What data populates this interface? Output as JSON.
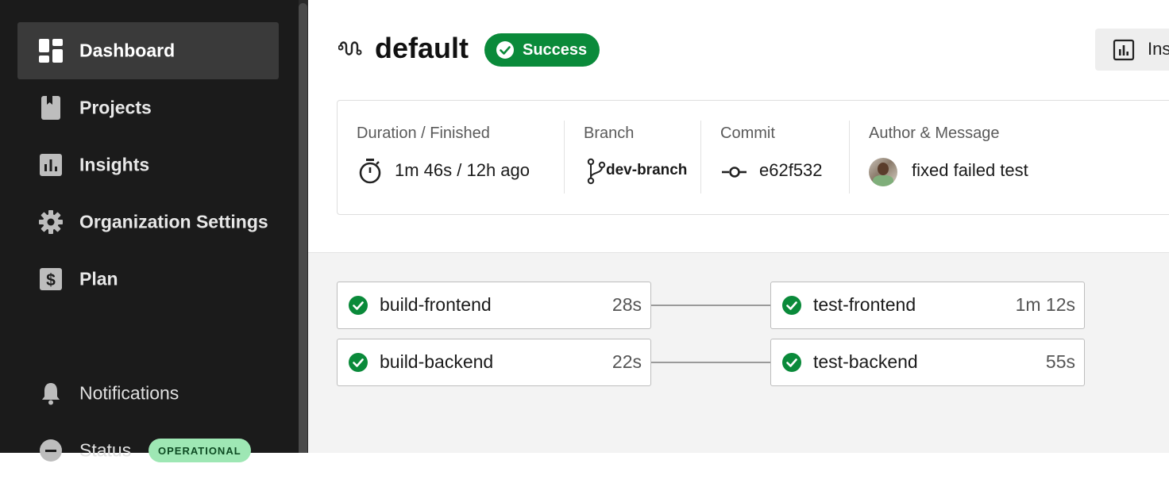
{
  "sidebar": {
    "items": [
      {
        "label": "Dashboard",
        "icon": "dashboard-icon"
      },
      {
        "label": "Projects",
        "icon": "projects-icon"
      },
      {
        "label": "Insights",
        "icon": "insights-icon"
      },
      {
        "label": "Organization Settings",
        "icon": "gear-icon"
      },
      {
        "label": "Plan",
        "icon": "dollar-icon"
      }
    ],
    "notifications": "Notifications",
    "status": {
      "label": "Status",
      "badge": "OPERATIONAL"
    }
  },
  "header": {
    "title": "default",
    "status": "Success",
    "insights_button": "Ins"
  },
  "info": {
    "duration": {
      "label": "Duration / Finished",
      "value": "1m 46s / 12h ago"
    },
    "branch": {
      "label": "Branch",
      "value": "dev-branch"
    },
    "commit": {
      "label": "Commit",
      "value": "e62f532"
    },
    "author": {
      "label": "Author & Message",
      "message": "fixed failed test"
    }
  },
  "jobs": [
    {
      "name": "build-frontend",
      "duration": "28s"
    },
    {
      "name": "test-frontend",
      "duration": "1m 12s"
    },
    {
      "name": "build-backend",
      "duration": "22s"
    },
    {
      "name": "test-backend",
      "duration": "55s"
    }
  ],
  "colors": {
    "success": "#0a8a3a",
    "link": "#0b6fc4",
    "sidebar": "#1b1b1b",
    "badge": "#9ee7b4"
  }
}
